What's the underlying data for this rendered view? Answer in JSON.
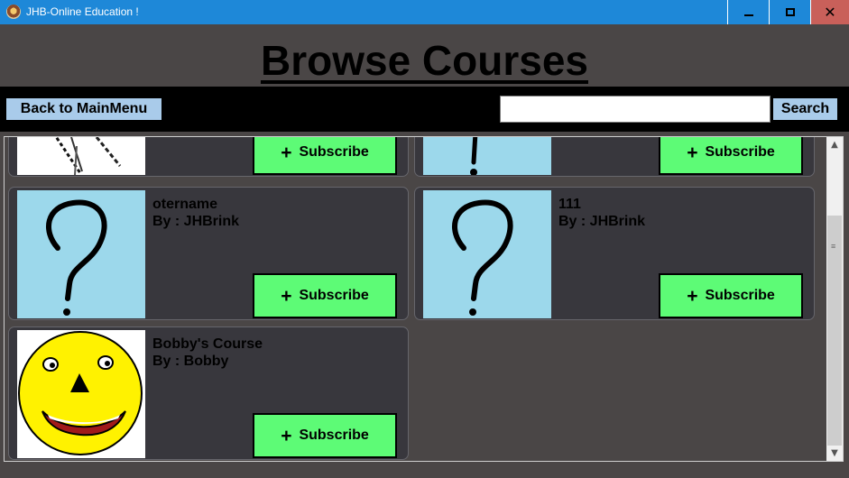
{
  "window": {
    "title": "JHB-Online Education !",
    "minimize_glyph": "",
    "maximize_glyph": "",
    "close_glyph": "✕"
  },
  "header": {
    "title": "Browse Courses"
  },
  "toolbar": {
    "back_label": "Back to MainMenu",
    "search_value": "",
    "search_label": "Search"
  },
  "courses": [
    {
      "name": "",
      "author": "",
      "subscribe_label": "Subscribe",
      "thumbnail": "sketch-icon"
    },
    {
      "name": "",
      "author": "",
      "subscribe_label": "Subscribe",
      "thumbnail": "question-mark-icon"
    },
    {
      "name": "otername",
      "author": "By : JHBrink",
      "subscribe_label": "Subscribe",
      "thumbnail": "question-mark-icon"
    },
    {
      "name": "111",
      "author": "By : JHBrink",
      "subscribe_label": "Subscribe",
      "thumbnail": "question-mark-icon"
    },
    {
      "name": "Bobby's Course",
      "author": "By : Bobby",
      "subscribe_label": "Subscribe",
      "thumbnail": "smiley-face-icon"
    }
  ],
  "colors": {
    "titlebar": "#1e88d8",
    "background": "#4a4646",
    "card": "#38373d",
    "subscribe": "#5dfb76",
    "toolbar_button": "#a9cbea",
    "thumb_blue": "#9cd8eb",
    "smiley": "#fff200"
  }
}
